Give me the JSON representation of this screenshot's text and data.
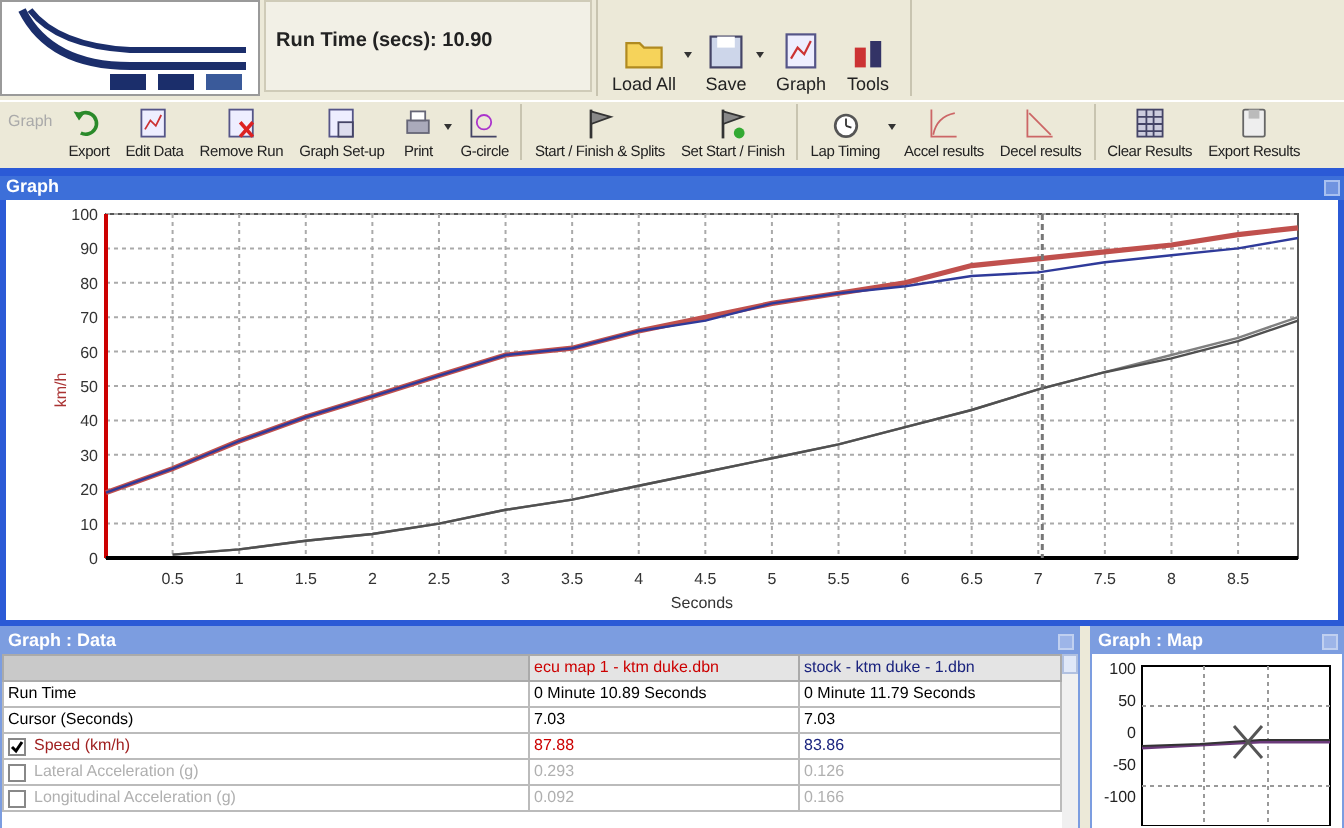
{
  "run_info": {
    "text": "Run Time (secs): 10.90"
  },
  "file_toolbar": [
    {
      "label": "Load All",
      "dropdown": true
    },
    {
      "label": "Save",
      "dropdown": true
    },
    {
      "label": "Graph",
      "dropdown": false
    },
    {
      "label": "Tools",
      "dropdown": false
    }
  ],
  "toolbar": {
    "groups": [
      [
        {
          "kind": "label",
          "label": "Graph"
        },
        {
          "kind": "button",
          "label": "Export",
          "dropdown": false
        },
        {
          "kind": "button",
          "label": "Edit Data",
          "dropdown": false
        },
        {
          "kind": "button",
          "label": "Remove Run",
          "dropdown": false
        },
        {
          "kind": "button",
          "label": "Graph Set-up",
          "dropdown": false
        },
        {
          "kind": "button",
          "label": "Print",
          "dropdown": true
        },
        {
          "kind": "button",
          "label": "G-circle",
          "dropdown": false
        }
      ],
      [
        {
          "kind": "button",
          "label": "Start / Finish & Splits",
          "dropdown": false
        },
        {
          "kind": "button",
          "label": "Set Start / Finish",
          "dropdown": false
        }
      ],
      [
        {
          "kind": "button",
          "label": "Lap Timing",
          "dropdown": true
        },
        {
          "kind": "button",
          "label": "Accel results",
          "dropdown": false
        },
        {
          "kind": "button",
          "label": "Decel results",
          "dropdown": false
        }
      ],
      [
        {
          "kind": "button",
          "label": "Clear Results",
          "dropdown": false
        },
        {
          "kind": "button",
          "label": "Export Results",
          "dropdown": false
        }
      ]
    ]
  },
  "graph_window": {
    "title": "Graph",
    "chart_data": {
      "type": "line",
      "xlabel": "Seconds",
      "ylabel": "km/h",
      "grid": true,
      "ref_lines": [
        {
          "axis": "x",
          "value": 7.03,
          "color": "#777777"
        }
      ],
      "x": [
        0,
        0.5,
        1,
        1.5,
        2,
        2.5,
        3,
        3.5,
        4,
        4.5,
        5,
        5.5,
        6,
        6.5,
        7,
        7.5,
        8,
        8.5,
        8.95
      ],
      "series": [
        {
          "color": "#c0504d",
          "values": [
            19,
            26,
            34,
            41,
            47,
            53,
            59,
            61,
            66,
            70,
            74,
            77,
            80,
            85,
            87,
            89,
            91,
            94,
            96
          ]
        },
        {
          "color": "#2f3a9a",
          "values": [
            19,
            26,
            34,
            41,
            47,
            53,
            59,
            61,
            66,
            69,
            74,
            77,
            79,
            82,
            83,
            86,
            88,
            90,
            93
          ]
        },
        {
          "color": "#808080",
          "values": [
            null,
            1,
            2.5,
            5,
            7,
            10,
            14,
            17,
            21,
            25,
            29,
            33,
            38,
            43,
            49,
            54,
            59,
            64,
            70
          ]
        },
        {
          "color": "#505050",
          "values": [
            null,
            1,
            2.5,
            5,
            7,
            10,
            14,
            17,
            21,
            25,
            29,
            33,
            38,
            43,
            49,
            54,
            58,
            63,
            69
          ]
        }
      ],
      "xlim": [
        0,
        8.95
      ],
      "ylim": [
        0,
        100
      ],
      "xticks": [
        0.5,
        1,
        1.5,
        2,
        2.5,
        3,
        3.5,
        4,
        4.5,
        5,
        5.5,
        6,
        6.5,
        7,
        7.5,
        8,
        8.5
      ],
      "yticks": [
        0,
        10,
        20,
        30,
        40,
        50,
        60,
        70,
        80,
        90,
        100
      ]
    }
  },
  "data_window": {
    "title": "Graph : Data",
    "columns": [
      {
        "label": "ecu map 1 - ktm duke.dbn",
        "color": "#cc0000"
      },
      {
        "label": "stock - ktm duke - 1.dbn",
        "color": "#1a237e"
      }
    ],
    "rows": [
      {
        "kind": "text",
        "label": "Run Time",
        "values": [
          "0 Minute 10.89 Seconds",
          "0 Minute 11.79 Seconds"
        ]
      },
      {
        "kind": "text",
        "label": "Cursor (Seconds)",
        "values": [
          "7.03",
          "7.03"
        ]
      },
      {
        "kind": "check",
        "label": "Speed (km/h)",
        "checked": true,
        "values": [
          "87.88",
          "83.86"
        ]
      },
      {
        "kind": "check",
        "label": "Lateral Acceleration (g)",
        "checked": false,
        "values": [
          "0.293",
          "0.126"
        ]
      },
      {
        "kind": "check",
        "label": "Longitudinal Acceleration (g)",
        "checked": false,
        "values": [
          "0.092",
          "0.166"
        ]
      }
    ]
  },
  "map_window": {
    "title": "Graph : Map",
    "y_ticks": [
      "100",
      "50",
      "0",
      "-50",
      "-100"
    ]
  }
}
